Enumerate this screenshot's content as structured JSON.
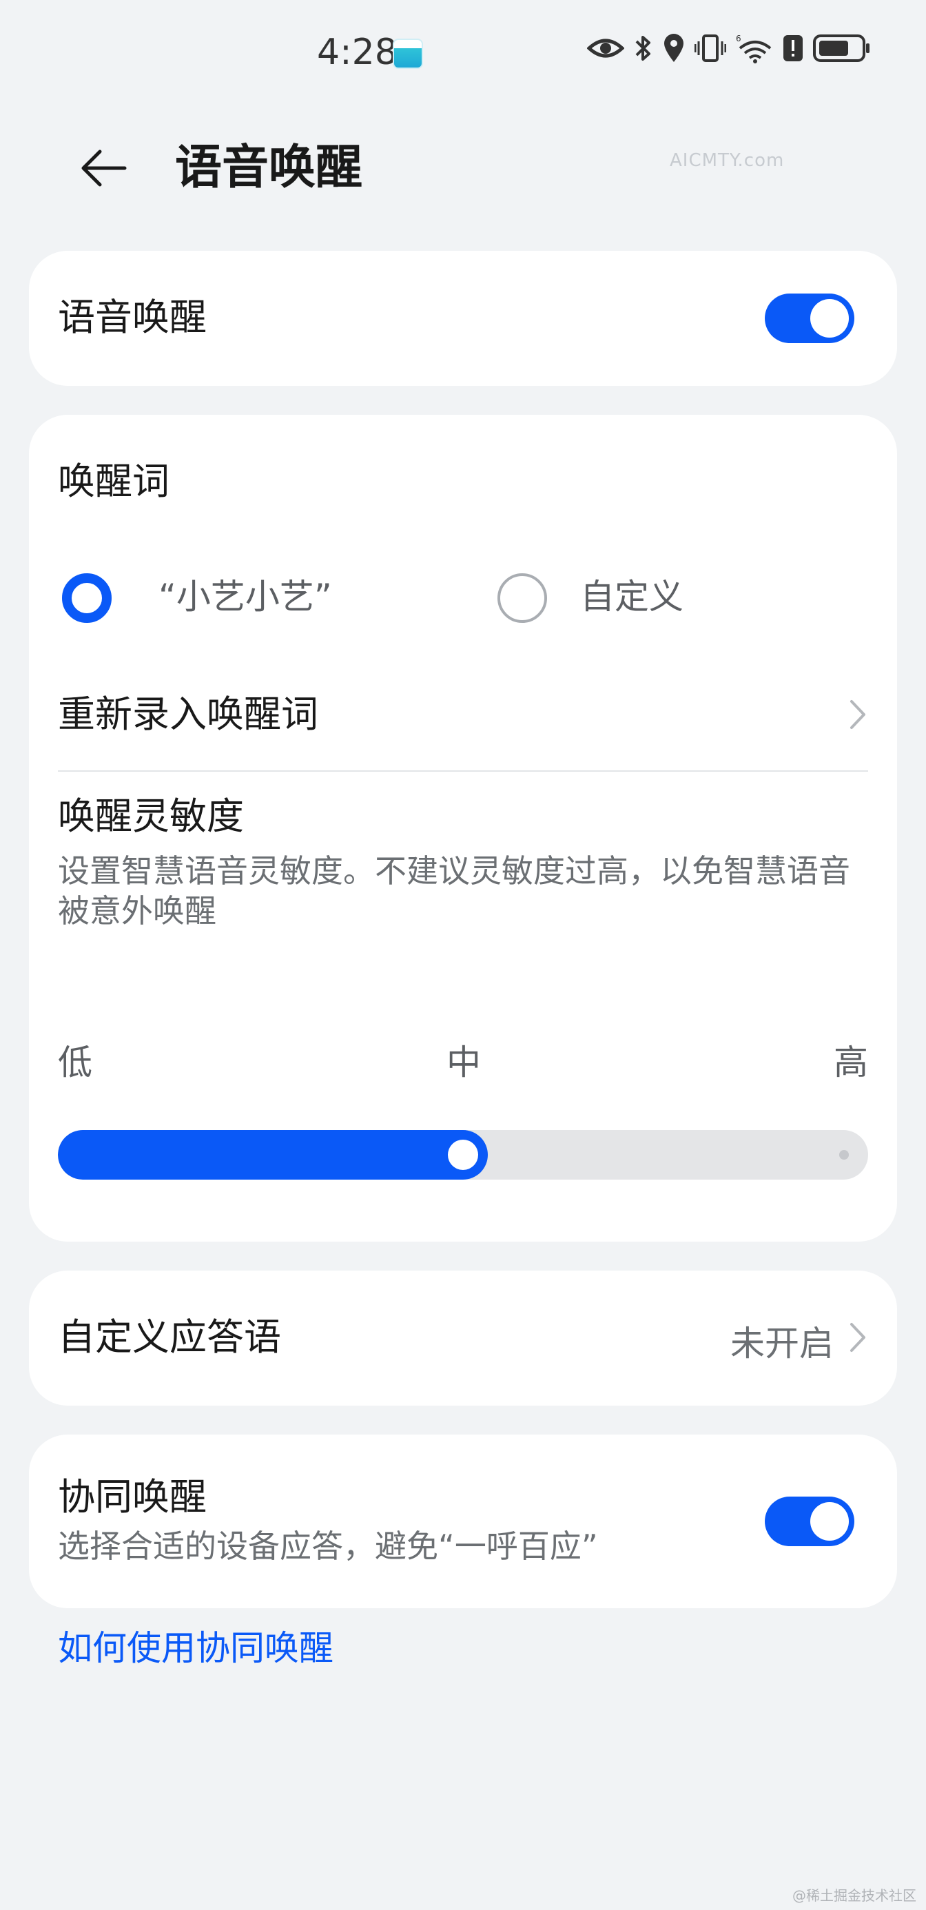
{
  "status_bar": {
    "time": "4:28"
  },
  "header": {
    "title": "语音唤醒",
    "watermark": "AICMTY.com"
  },
  "voice_wake": {
    "label": "语音唤醒",
    "enabled": true
  },
  "wake_word": {
    "section_title": "唤醒词",
    "options": [
      {
        "label": "“小艺小艺”",
        "selected": true
      },
      {
        "label": "自定义",
        "selected": false
      }
    ],
    "re_record_label": "重新录入唤醒词"
  },
  "sensitivity": {
    "title": "唤醒灵敏度",
    "description": "设置智慧语音灵敏度。不建议灵敏度过高，以免智慧语音被意外唤醒",
    "scale_labels": [
      "低",
      "中",
      "高"
    ],
    "level_fraction": 0.5
  },
  "custom_reply": {
    "label": "自定义应答语",
    "value": "未开启"
  },
  "coop_wake": {
    "title": "协同唤醒",
    "description": "选择合适的设备应答，避免“一呼百应”",
    "enabled": true
  },
  "help_link": "如何使用协同唤醒",
  "footer_mark": "@稀土掘金技术社区",
  "colors": {
    "accent": "#0a59f7",
    "background": "#f1f3f5",
    "card": "#ffffff"
  }
}
